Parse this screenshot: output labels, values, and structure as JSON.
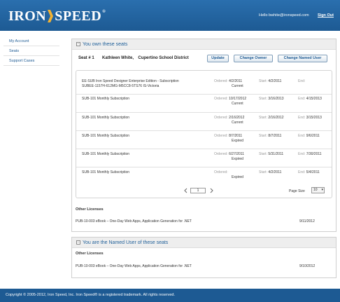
{
  "header": {
    "logo_left": "IRON",
    "logo_right": "SPEED",
    "logo_reg": "®",
    "user_text": "Hello bwhite@ironspeed.com",
    "sign_out": "Sign Out"
  },
  "sidebar": {
    "items": [
      {
        "label": "My Account"
      },
      {
        "label": "Seats"
      },
      {
        "label": "Support Cases"
      }
    ]
  },
  "owned_panel": {
    "title": "You own these seats",
    "seat_label": "Seat # 1",
    "seat_owner": "Kathleen White,",
    "seat_org": "Cupertino School District",
    "buttons": {
      "update": "Update",
      "change_owner": "Change Owner",
      "change_named_user": "Change Named User"
    }
  },
  "subscriptions": {
    "ordered_label": "Ordered:",
    "start_label": "Start:",
    "end_label": "End:",
    "rows": [
      {
        "name": "EE-SUB Iron Speed Designer Enterprise Edition - Subscription",
        "name2": "SUBEE-1157H-612MG-M5CC8-5TS76   IS-Victoria",
        "ordered": "4/2/2011",
        "status": "Current",
        "start": "4/2/2011",
        "end": ""
      },
      {
        "name": "SUB-101 Monthly Subscription",
        "name2": "",
        "ordered": "10/17/2012",
        "status": "Current",
        "start": "3/16/2013",
        "end": "4/15/2013"
      },
      {
        "name": "SUB-101 Monthly Subscription",
        "name2": "",
        "ordered": "2/16/2012",
        "status": "Current",
        "start": "2/16/2012",
        "end": "3/15/2013"
      },
      {
        "name": "SUB-101 Monthly Subscription",
        "name2": "",
        "ordered": "8/7/2011",
        "status": "Expired",
        "start": "8/7/2011",
        "end": "9/6/2011"
      },
      {
        "name": "SUB-101 Monthly Subscription",
        "name2": "",
        "ordered": "6/27/2011",
        "status": "Expired",
        "start": "5/31/2011",
        "end": "7/30/2011"
      },
      {
        "name": "SUB-101 Monthly Subscription",
        "name2": "",
        "ordered": "",
        "status": "Expired",
        "start": "4/2/2011",
        "end": "5/4/2011"
      }
    ]
  },
  "pager": {
    "page": "1",
    "page_size_label": "Page Size",
    "page_size": "10"
  },
  "other_licenses": {
    "title": "Other Licenses",
    "items": [
      {
        "name": "PUB-10-003 eBook – One-Day Web Apps, Application Generation for .NET",
        "date": "9/11/2012"
      }
    ]
  },
  "named_panel": {
    "title": "You are the Named User of these seats",
    "section": "Other Licenses",
    "items": [
      {
        "name": "PUB-10-003 eBook – One-Day Web Apps, Application Generation for .NET",
        "date": "9/10/2012"
      }
    ]
  },
  "footer": {
    "text": "Copyright © 2005-2012, Iron Speed, Inc. Iron Speed® is a registered trademark. All rights reserved."
  },
  "colors": {
    "header_blue": "#1f5f99",
    "link_blue": "#1d5a93",
    "panel_head_bg": "#eeeeee"
  }
}
